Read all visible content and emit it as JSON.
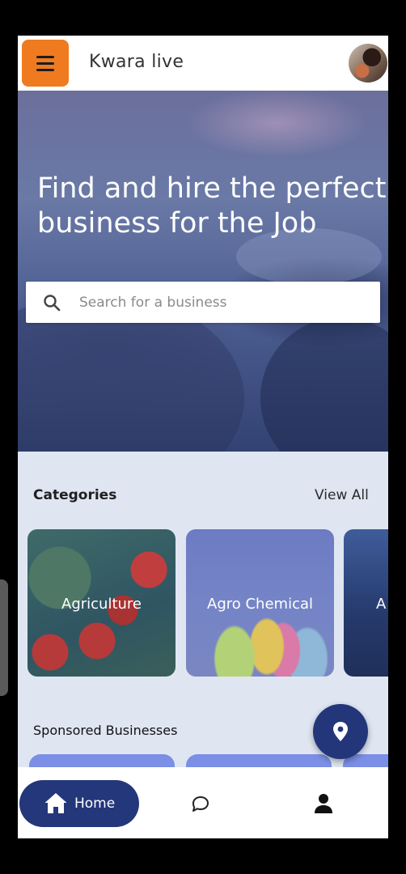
{
  "header": {
    "title": "Kwara live"
  },
  "hero": {
    "title_line1": "Find and hire the perfect",
    "title_line2": "business for the Job",
    "search_placeholder": "Search for a business"
  },
  "categories": {
    "heading": "Categories",
    "view_all": "View All",
    "items": [
      {
        "label": "Agriculture"
      },
      {
        "label": "Agro Chemical"
      },
      {
        "label": "A"
      }
    ]
  },
  "sponsored": {
    "heading": "Sponsored Businesses"
  },
  "bottom_nav": {
    "home_label": "Home"
  },
  "colors": {
    "menu_button": "#f07a1f",
    "primary_navy": "#24377a",
    "section_bg": "#dfe6f2"
  },
  "icons": {
    "menu": "hamburger-icon",
    "search": "search-icon",
    "location": "location-pin-icon",
    "home": "home-icon",
    "chat": "chat-icon",
    "profile": "person-icon"
  }
}
